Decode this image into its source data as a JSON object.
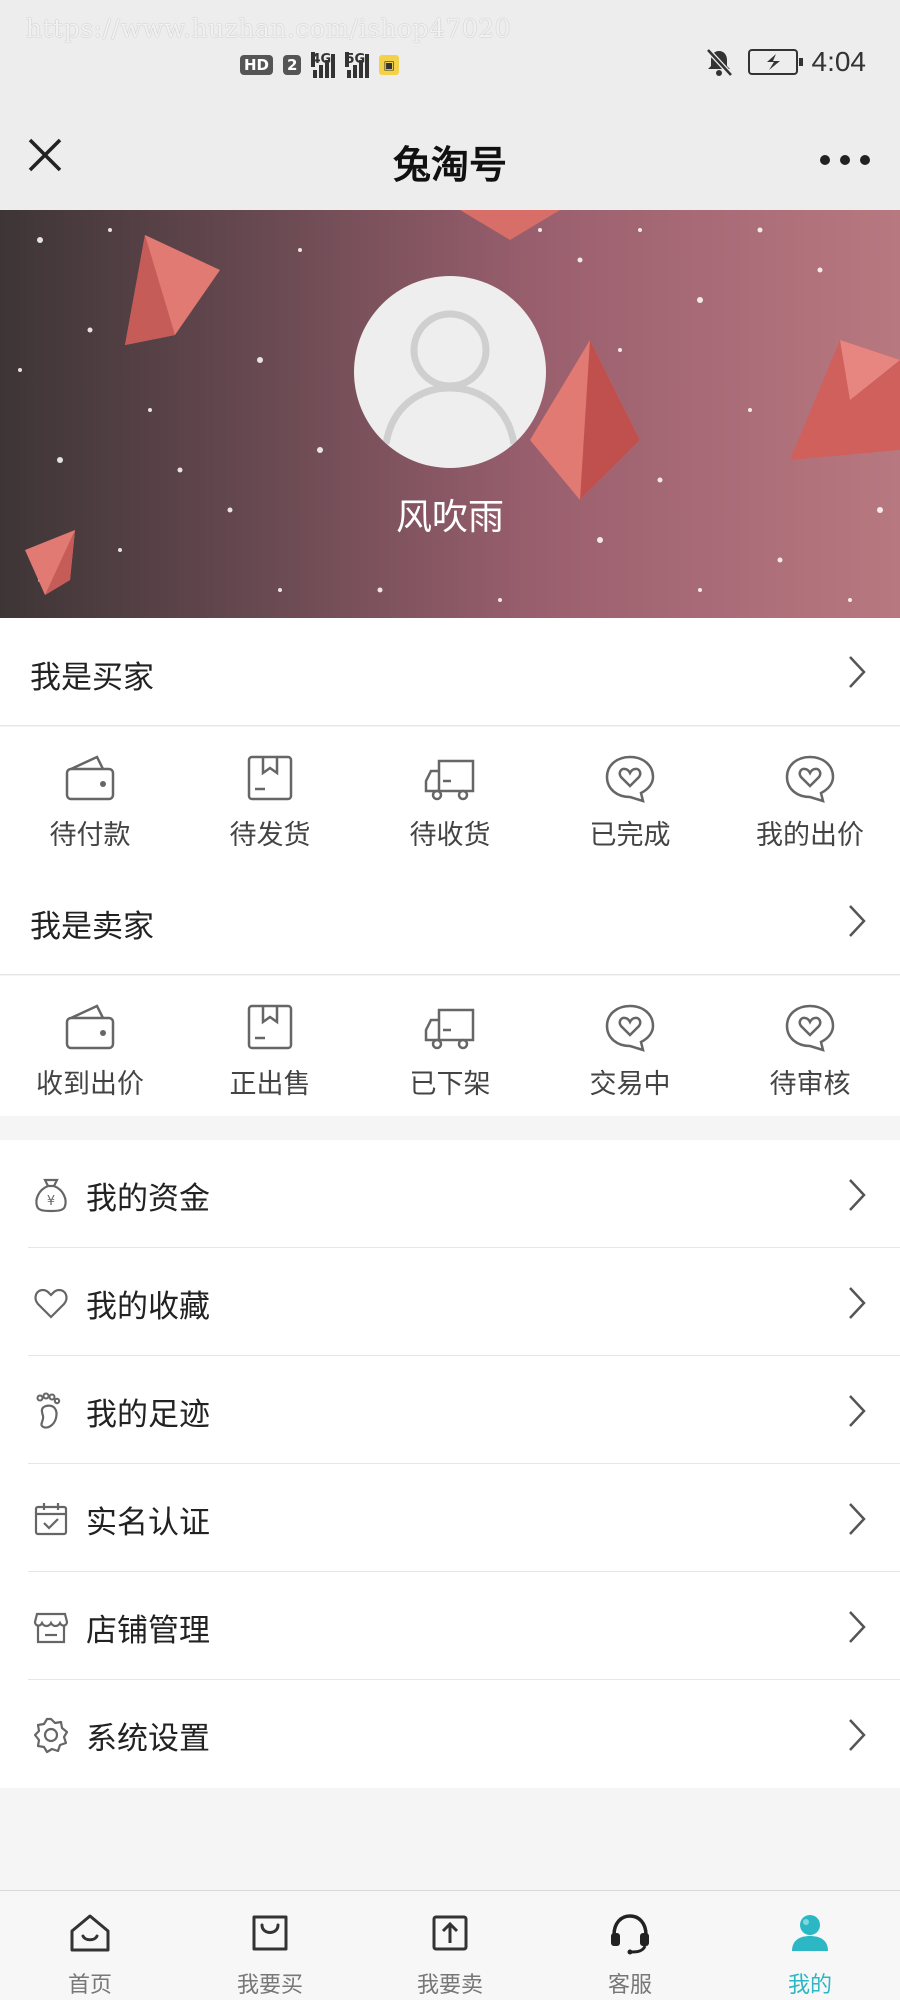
{
  "watermark": "https://www.huzhan.com/ishop47020",
  "status_bar": {
    "hd_label": "HD",
    "sim1_label": "2",
    "net1": "4G",
    "net2": "5G",
    "time": "4:04"
  },
  "navbar": {
    "title": "兔淘号"
  },
  "profile": {
    "username": "风吹雨"
  },
  "buyer": {
    "title": "我是买家",
    "items": [
      {
        "label": "待付款",
        "icon": "wallet-icon"
      },
      {
        "label": "待发货",
        "icon": "package-icon"
      },
      {
        "label": "待收货",
        "icon": "truck-icon"
      },
      {
        "label": "已完成",
        "icon": "heart-bubble-icon"
      },
      {
        "label": "我的出价",
        "icon": "heart-bubble-icon"
      }
    ]
  },
  "seller": {
    "title": "我是卖家",
    "items": [
      {
        "label": "收到出价",
        "icon": "wallet-icon"
      },
      {
        "label": "正出售",
        "icon": "package-icon"
      },
      {
        "label": "已下架",
        "icon": "truck-icon"
      },
      {
        "label": "交易中",
        "icon": "heart-bubble-icon"
      },
      {
        "label": "待审核",
        "icon": "heart-bubble-icon"
      }
    ]
  },
  "menu": [
    {
      "label": "我的资金",
      "icon": "money-bag-icon"
    },
    {
      "label": "我的收藏",
      "icon": "heart-icon"
    },
    {
      "label": "我的足迹",
      "icon": "footprint-icon"
    },
    {
      "label": "实名认证",
      "icon": "calendar-check-icon"
    },
    {
      "label": "店铺管理",
      "icon": "store-icon"
    },
    {
      "label": "系统设置",
      "icon": "gear-icon"
    }
  ],
  "tabbar": [
    {
      "label": "首页",
      "icon": "home-icon",
      "active": false
    },
    {
      "label": "我要买",
      "icon": "shopping-bag-icon",
      "active": false
    },
    {
      "label": "我要卖",
      "icon": "upload-icon",
      "active": false
    },
    {
      "label": "客服",
      "icon": "headset-icon",
      "active": false
    },
    {
      "label": "我的",
      "icon": "user-icon",
      "active": true
    }
  ],
  "colors": {
    "accent": "#2bb7c4",
    "banner_start": "#3d3536",
    "banner_end": "#b87880"
  }
}
